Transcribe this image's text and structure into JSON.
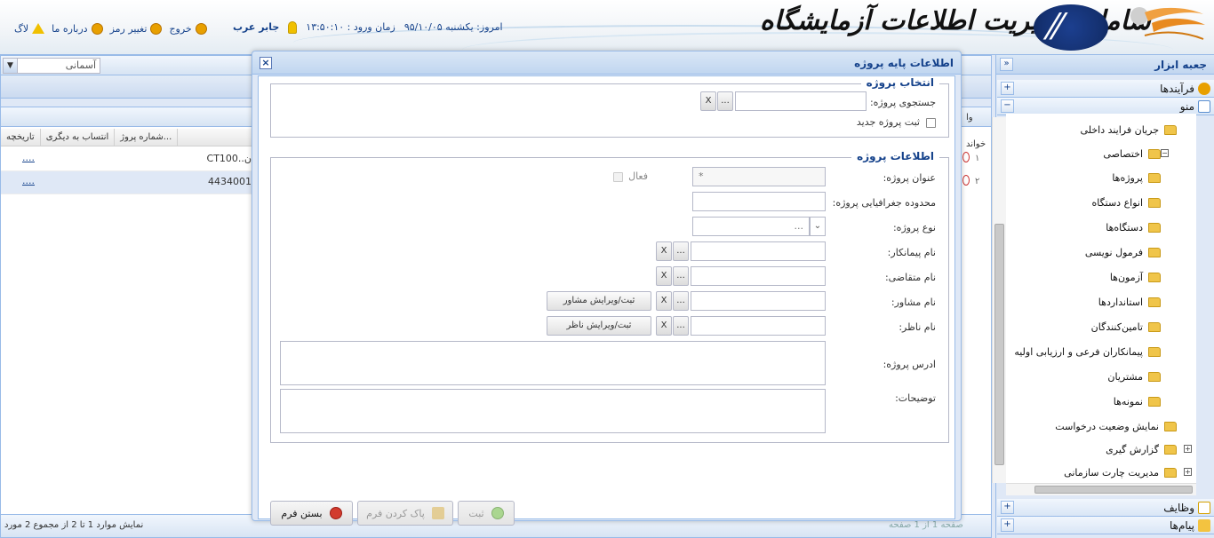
{
  "header": {
    "system_title": "سامانه مدیریت اطلاعات آزمایشگاه",
    "logo_right_text": "مدیریت اطلاعات آزمایشگاهی",
    "session": {
      "today_label": "امروز: یکشنبه ۹۵/۱۰/۰۵",
      "login_time_label": "زمان ورود : ۱۳:۵۰:۱۰",
      "user_name": "جابر عرب"
    },
    "links": {
      "log": "لاگ",
      "about": "درباره ما",
      "change_password": "تغییر رمز",
      "logout": "خروج"
    }
  },
  "background_panel": {
    "theme_select_value": "آسمانی",
    "grid_columns": [
      "تاریخچه",
      "انتساب به دیگری",
      "شماره پروژ..."
    ],
    "rows": [
      {
        "number": "۱",
        "code": "CT100..ن",
        "link": "...."
      },
      {
        "number": "۲",
        "code": "4434001",
        "link": "...."
      }
    ],
    "edge_text": "خواند",
    "edge_text2": "وا",
    "paging_info": "نمایش موارد 1 تا 2 از مجموع 2 مورد",
    "pager_tail": "صفحه 1 از 1 صفحه"
  },
  "sidebar": {
    "title": "جعبه ابزار",
    "sections": {
      "processes": "فرآیندها",
      "menu": "منو",
      "tasks": "وظایف",
      "messages": "پیام‌ها"
    },
    "tree": [
      {
        "label": "جریان فرایند داخلی",
        "level": 0
      },
      {
        "label": "اختصاصی",
        "level": 0
      },
      {
        "label": "پروژه‌ها",
        "level": 1
      },
      {
        "label": "انواع دستگاه",
        "level": 1
      },
      {
        "label": "دستگاه‌ها",
        "level": 1
      },
      {
        "label": "فرمول نویسی",
        "level": 1
      },
      {
        "label": "آزمون‌ها",
        "level": 1
      },
      {
        "label": "استانداردها",
        "level": 1
      },
      {
        "label": "تامین‌کنندگان",
        "level": 1
      },
      {
        "label": "پیمانکاران فرعی و ارزیابی اولیه",
        "level": 1
      },
      {
        "label": "مشتریان",
        "level": 1
      },
      {
        "label": "نمونه‌ها",
        "level": 1
      },
      {
        "label": "نمایش وضعیت درخواست",
        "level": 0
      },
      {
        "label": "گزارش گیری",
        "level": 0
      },
      {
        "label": "مدیریت چارت سازمانی",
        "level": 0
      }
    ]
  },
  "dialog": {
    "title": "اطلاعات پایه پروژه",
    "select_section": {
      "legend": "انتخاب پروژه",
      "search_label": "جستجوی پروژه:",
      "new_project_label": "ثبت پروژه جدید"
    },
    "info_section": {
      "legend": "اطلاعات پروژه",
      "title_label": "عنوان پروژه:",
      "title_value": "*",
      "active_label": "فعال",
      "geo_label": "محدوده جغرافیایی پروژه:",
      "type_label": "نوع پروژه:",
      "type_value": "...",
      "contractor_label": "نام پیمانکار:",
      "applicant_label": "نام متقاضی:",
      "consultant_label": "نام مشاور:",
      "consultant_button": "ثبت/ویرایش مشاور",
      "supervisor_label": "نام ناظر:",
      "supervisor_button": "ثبت/ویرایش ناظر",
      "address_label": "ادرس پروژه:",
      "notes_label": "توضیحات:"
    },
    "picker": {
      "dots": "...",
      "clear": "X"
    },
    "footer": {
      "close_label": "بستن فرم",
      "clear_label": "پاک کردن فرم",
      "save_label": "ثبت"
    }
  },
  "colors": {
    "panel_blue": "#dfe8f6",
    "title_text": "#15428b",
    "border": "#99bbe8"
  }
}
